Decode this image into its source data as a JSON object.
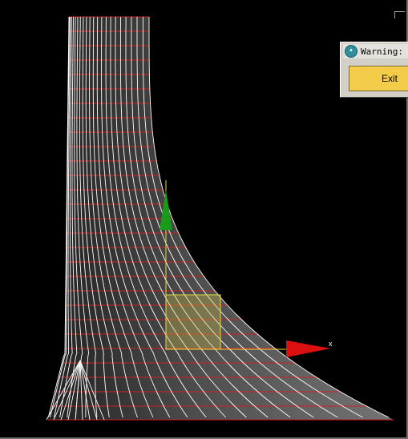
{
  "viewport": {
    "axis_x_label": "x"
  },
  "warning_dialog": {
    "title": "Warning:",
    "exit_label": "Exit",
    "title_icon": "3ds-max-app-icon"
  },
  "colors": {
    "background": "#000000",
    "wireframe_white": "#ffffff",
    "wireframe_red": "#cc2020",
    "gizmo_y": "#1a9a1a",
    "gizmo_x": "#dd1010",
    "gizmo_plane": "#d8c848",
    "gizmo_axis_line": "#e8d840",
    "button_yellow": "#f3cd4a"
  }
}
